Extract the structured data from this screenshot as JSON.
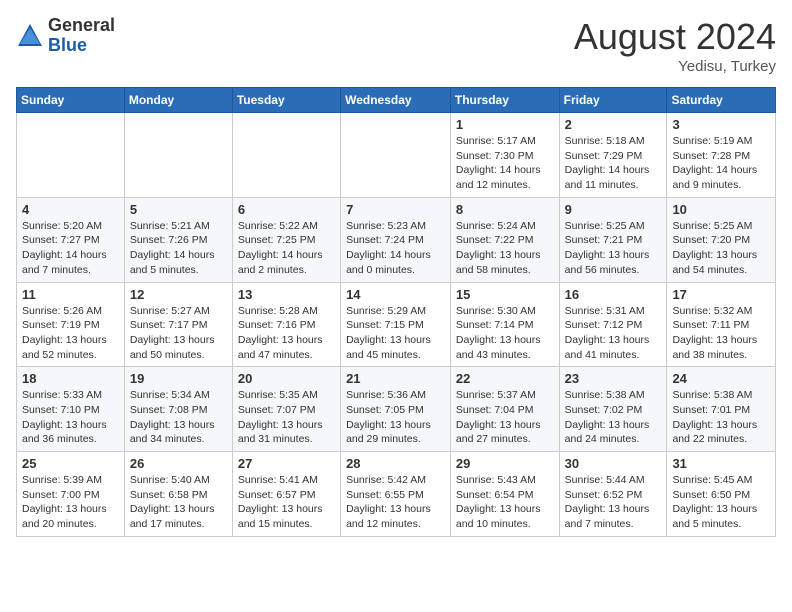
{
  "logo": {
    "general": "General",
    "blue": "Blue"
  },
  "title": "August 2024",
  "location": "Yedisu, Turkey",
  "days_of_week": [
    "Sunday",
    "Monday",
    "Tuesday",
    "Wednesday",
    "Thursday",
    "Friday",
    "Saturday"
  ],
  "weeks": [
    [
      {
        "day": "",
        "info": ""
      },
      {
        "day": "",
        "info": ""
      },
      {
        "day": "",
        "info": ""
      },
      {
        "day": "",
        "info": ""
      },
      {
        "day": "1",
        "info": "Sunrise: 5:17 AM\nSunset: 7:30 PM\nDaylight: 14 hours\nand 12 minutes."
      },
      {
        "day": "2",
        "info": "Sunrise: 5:18 AM\nSunset: 7:29 PM\nDaylight: 14 hours\nand 11 minutes."
      },
      {
        "day": "3",
        "info": "Sunrise: 5:19 AM\nSunset: 7:28 PM\nDaylight: 14 hours\nand 9 minutes."
      }
    ],
    [
      {
        "day": "4",
        "info": "Sunrise: 5:20 AM\nSunset: 7:27 PM\nDaylight: 14 hours\nand 7 minutes."
      },
      {
        "day": "5",
        "info": "Sunrise: 5:21 AM\nSunset: 7:26 PM\nDaylight: 14 hours\nand 5 minutes."
      },
      {
        "day": "6",
        "info": "Sunrise: 5:22 AM\nSunset: 7:25 PM\nDaylight: 14 hours\nand 2 minutes."
      },
      {
        "day": "7",
        "info": "Sunrise: 5:23 AM\nSunset: 7:24 PM\nDaylight: 14 hours\nand 0 minutes."
      },
      {
        "day": "8",
        "info": "Sunrise: 5:24 AM\nSunset: 7:22 PM\nDaylight: 13 hours\nand 58 minutes."
      },
      {
        "day": "9",
        "info": "Sunrise: 5:25 AM\nSunset: 7:21 PM\nDaylight: 13 hours\nand 56 minutes."
      },
      {
        "day": "10",
        "info": "Sunrise: 5:25 AM\nSunset: 7:20 PM\nDaylight: 13 hours\nand 54 minutes."
      }
    ],
    [
      {
        "day": "11",
        "info": "Sunrise: 5:26 AM\nSunset: 7:19 PM\nDaylight: 13 hours\nand 52 minutes."
      },
      {
        "day": "12",
        "info": "Sunrise: 5:27 AM\nSunset: 7:17 PM\nDaylight: 13 hours\nand 50 minutes."
      },
      {
        "day": "13",
        "info": "Sunrise: 5:28 AM\nSunset: 7:16 PM\nDaylight: 13 hours\nand 47 minutes."
      },
      {
        "day": "14",
        "info": "Sunrise: 5:29 AM\nSunset: 7:15 PM\nDaylight: 13 hours\nand 45 minutes."
      },
      {
        "day": "15",
        "info": "Sunrise: 5:30 AM\nSunset: 7:14 PM\nDaylight: 13 hours\nand 43 minutes."
      },
      {
        "day": "16",
        "info": "Sunrise: 5:31 AM\nSunset: 7:12 PM\nDaylight: 13 hours\nand 41 minutes."
      },
      {
        "day": "17",
        "info": "Sunrise: 5:32 AM\nSunset: 7:11 PM\nDaylight: 13 hours\nand 38 minutes."
      }
    ],
    [
      {
        "day": "18",
        "info": "Sunrise: 5:33 AM\nSunset: 7:10 PM\nDaylight: 13 hours\nand 36 minutes."
      },
      {
        "day": "19",
        "info": "Sunrise: 5:34 AM\nSunset: 7:08 PM\nDaylight: 13 hours\nand 34 minutes."
      },
      {
        "day": "20",
        "info": "Sunrise: 5:35 AM\nSunset: 7:07 PM\nDaylight: 13 hours\nand 31 minutes."
      },
      {
        "day": "21",
        "info": "Sunrise: 5:36 AM\nSunset: 7:05 PM\nDaylight: 13 hours\nand 29 minutes."
      },
      {
        "day": "22",
        "info": "Sunrise: 5:37 AM\nSunset: 7:04 PM\nDaylight: 13 hours\nand 27 minutes."
      },
      {
        "day": "23",
        "info": "Sunrise: 5:38 AM\nSunset: 7:02 PM\nDaylight: 13 hours\nand 24 minutes."
      },
      {
        "day": "24",
        "info": "Sunrise: 5:38 AM\nSunset: 7:01 PM\nDaylight: 13 hours\nand 22 minutes."
      }
    ],
    [
      {
        "day": "25",
        "info": "Sunrise: 5:39 AM\nSunset: 7:00 PM\nDaylight: 13 hours\nand 20 minutes."
      },
      {
        "day": "26",
        "info": "Sunrise: 5:40 AM\nSunset: 6:58 PM\nDaylight: 13 hours\nand 17 minutes."
      },
      {
        "day": "27",
        "info": "Sunrise: 5:41 AM\nSunset: 6:57 PM\nDaylight: 13 hours\nand 15 minutes."
      },
      {
        "day": "28",
        "info": "Sunrise: 5:42 AM\nSunset: 6:55 PM\nDaylight: 13 hours\nand 12 minutes."
      },
      {
        "day": "29",
        "info": "Sunrise: 5:43 AM\nSunset: 6:54 PM\nDaylight: 13 hours\nand 10 minutes."
      },
      {
        "day": "30",
        "info": "Sunrise: 5:44 AM\nSunset: 6:52 PM\nDaylight: 13 hours\nand 7 minutes."
      },
      {
        "day": "31",
        "info": "Sunrise: 5:45 AM\nSunset: 6:50 PM\nDaylight: 13 hours\nand 5 minutes."
      }
    ]
  ]
}
